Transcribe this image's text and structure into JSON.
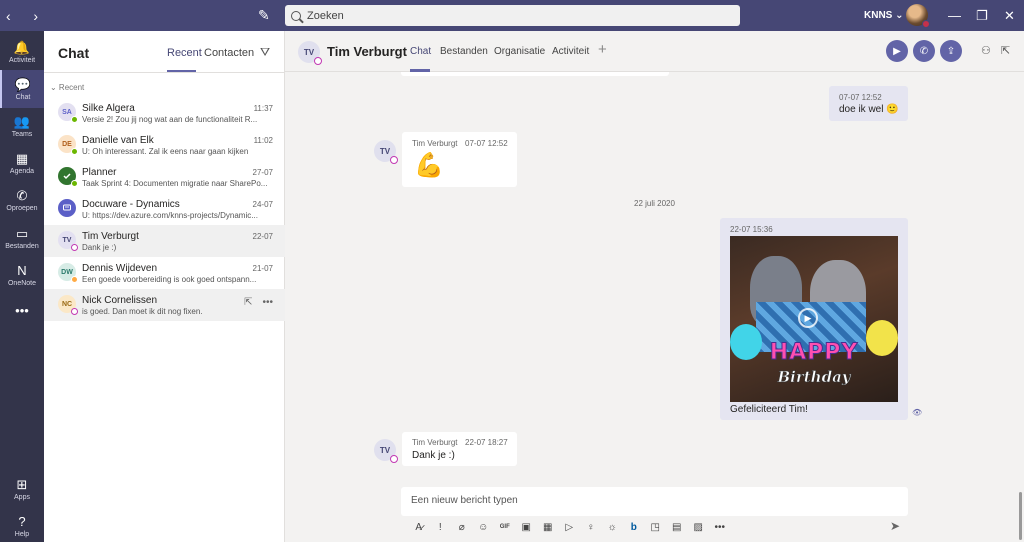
{
  "titlebar": {
    "search_placeholder": "Zoeken",
    "org": "KNNS ⌄",
    "nav_back": "‹",
    "nav_forward": "›",
    "compose_icon": "✎",
    "minimize": "—",
    "maximize": "❐",
    "close": "✕"
  },
  "rail": {
    "items": [
      {
        "label": "Activiteit",
        "icon": "🔔"
      },
      {
        "label": "Chat",
        "icon": "💬"
      },
      {
        "label": "Teams",
        "icon": "👥"
      },
      {
        "label": "Agenda",
        "icon": "▦"
      },
      {
        "label": "Oproepen",
        "icon": "✆"
      },
      {
        "label": "Bestanden",
        "icon": "▭"
      },
      {
        "label": "OneNote",
        "icon": "N"
      },
      {
        "label": "",
        "icon": "•••"
      }
    ],
    "apps_label": "Apps",
    "apps_icon": "⊞",
    "help_label": "Help",
    "help_icon": "?"
  },
  "chatlist": {
    "title": "Chat",
    "tab_recent": "Recent",
    "tab_contacts": "Contacten",
    "filter_icon": "⛛",
    "section": "⌄ Recent",
    "rows": [
      {
        "initials": "SA",
        "name": "Silke Algera",
        "time": "11:37",
        "preview": "Versie 2! Zou jij nog wat aan de functionaliteit R..."
      },
      {
        "initials": "DE",
        "name": "Danielle van Elk",
        "time": "11:02",
        "preview": "U: Oh interessant. Zal ik eens naar gaan kijken"
      },
      {
        "initials": "",
        "name": "Planner",
        "time": "27-07",
        "preview": "Taak Sprint 4: Documenten migratie naar SharePo..."
      },
      {
        "initials": "",
        "name": "Docuware - Dynamics",
        "time": "24-07",
        "preview": "U: https://dev.azure.com/knns-projects/Dynamic..."
      },
      {
        "initials": "TV",
        "name": "Tim Verburgt",
        "time": "22-07",
        "preview": "Dank je :)"
      },
      {
        "initials": "DW",
        "name": "Dennis Wijdeven",
        "time": "21-07",
        "preview": "Een goede voorbereiding is ook goed ontspann..."
      },
      {
        "initials": "NC",
        "name": "Nick Cornelissen",
        "time": "",
        "preview": "is goed. Dan moet ik dit nog fixen."
      }
    ],
    "row_popout_icon": "⇱",
    "row_more_icon": "•••"
  },
  "chatheader": {
    "initials": "TV",
    "name": "Tim Verburgt",
    "tabs": [
      "Chat",
      "Bestanden",
      "Organisatie",
      "Activiteit"
    ],
    "plus": "+",
    "video_icon": "▶",
    "call_icon": "✆",
    "share_icon": "⇪",
    "people_icon": "⚇",
    "popout_icon": "⇱"
  },
  "messages": {
    "m1": {
      "meta": "07-07 12:52",
      "text": "doe ik wel 🙂"
    },
    "m2": {
      "initials": "TV",
      "author": "Tim Verburgt",
      "time": "07-07 12:52",
      "emoji": "💪"
    },
    "date_sep": "22 juli 2020",
    "m3": {
      "meta": "22-07 15:36",
      "gif_text_1": "HAPPY",
      "gif_text_2": "Birthday",
      "caption": "Gefeliciteerd Tim!",
      "seen_icon": "👁"
    },
    "m4": {
      "initials": "TV",
      "author": "Tim Verburgt",
      "time": "22-07 18:27",
      "text": "Dank je :)"
    }
  },
  "compose": {
    "placeholder": "Een nieuw bericht typen",
    "tools": [
      "A̷",
      "!",
      "⌀",
      "☺",
      "GIF",
      "▣",
      "▦",
      "▷",
      "♀",
      "☼",
      "b",
      "◳",
      "▤",
      "▨",
      "•••"
    ],
    "send_icon": "➤"
  },
  "colors": {
    "titlebar": "#464775",
    "rail": "#33344a",
    "accent": "#6264a7",
    "presence_available": "#6bb700",
    "presence_away": "#ffaa44",
    "presence_offline": "#c239b3"
  }
}
